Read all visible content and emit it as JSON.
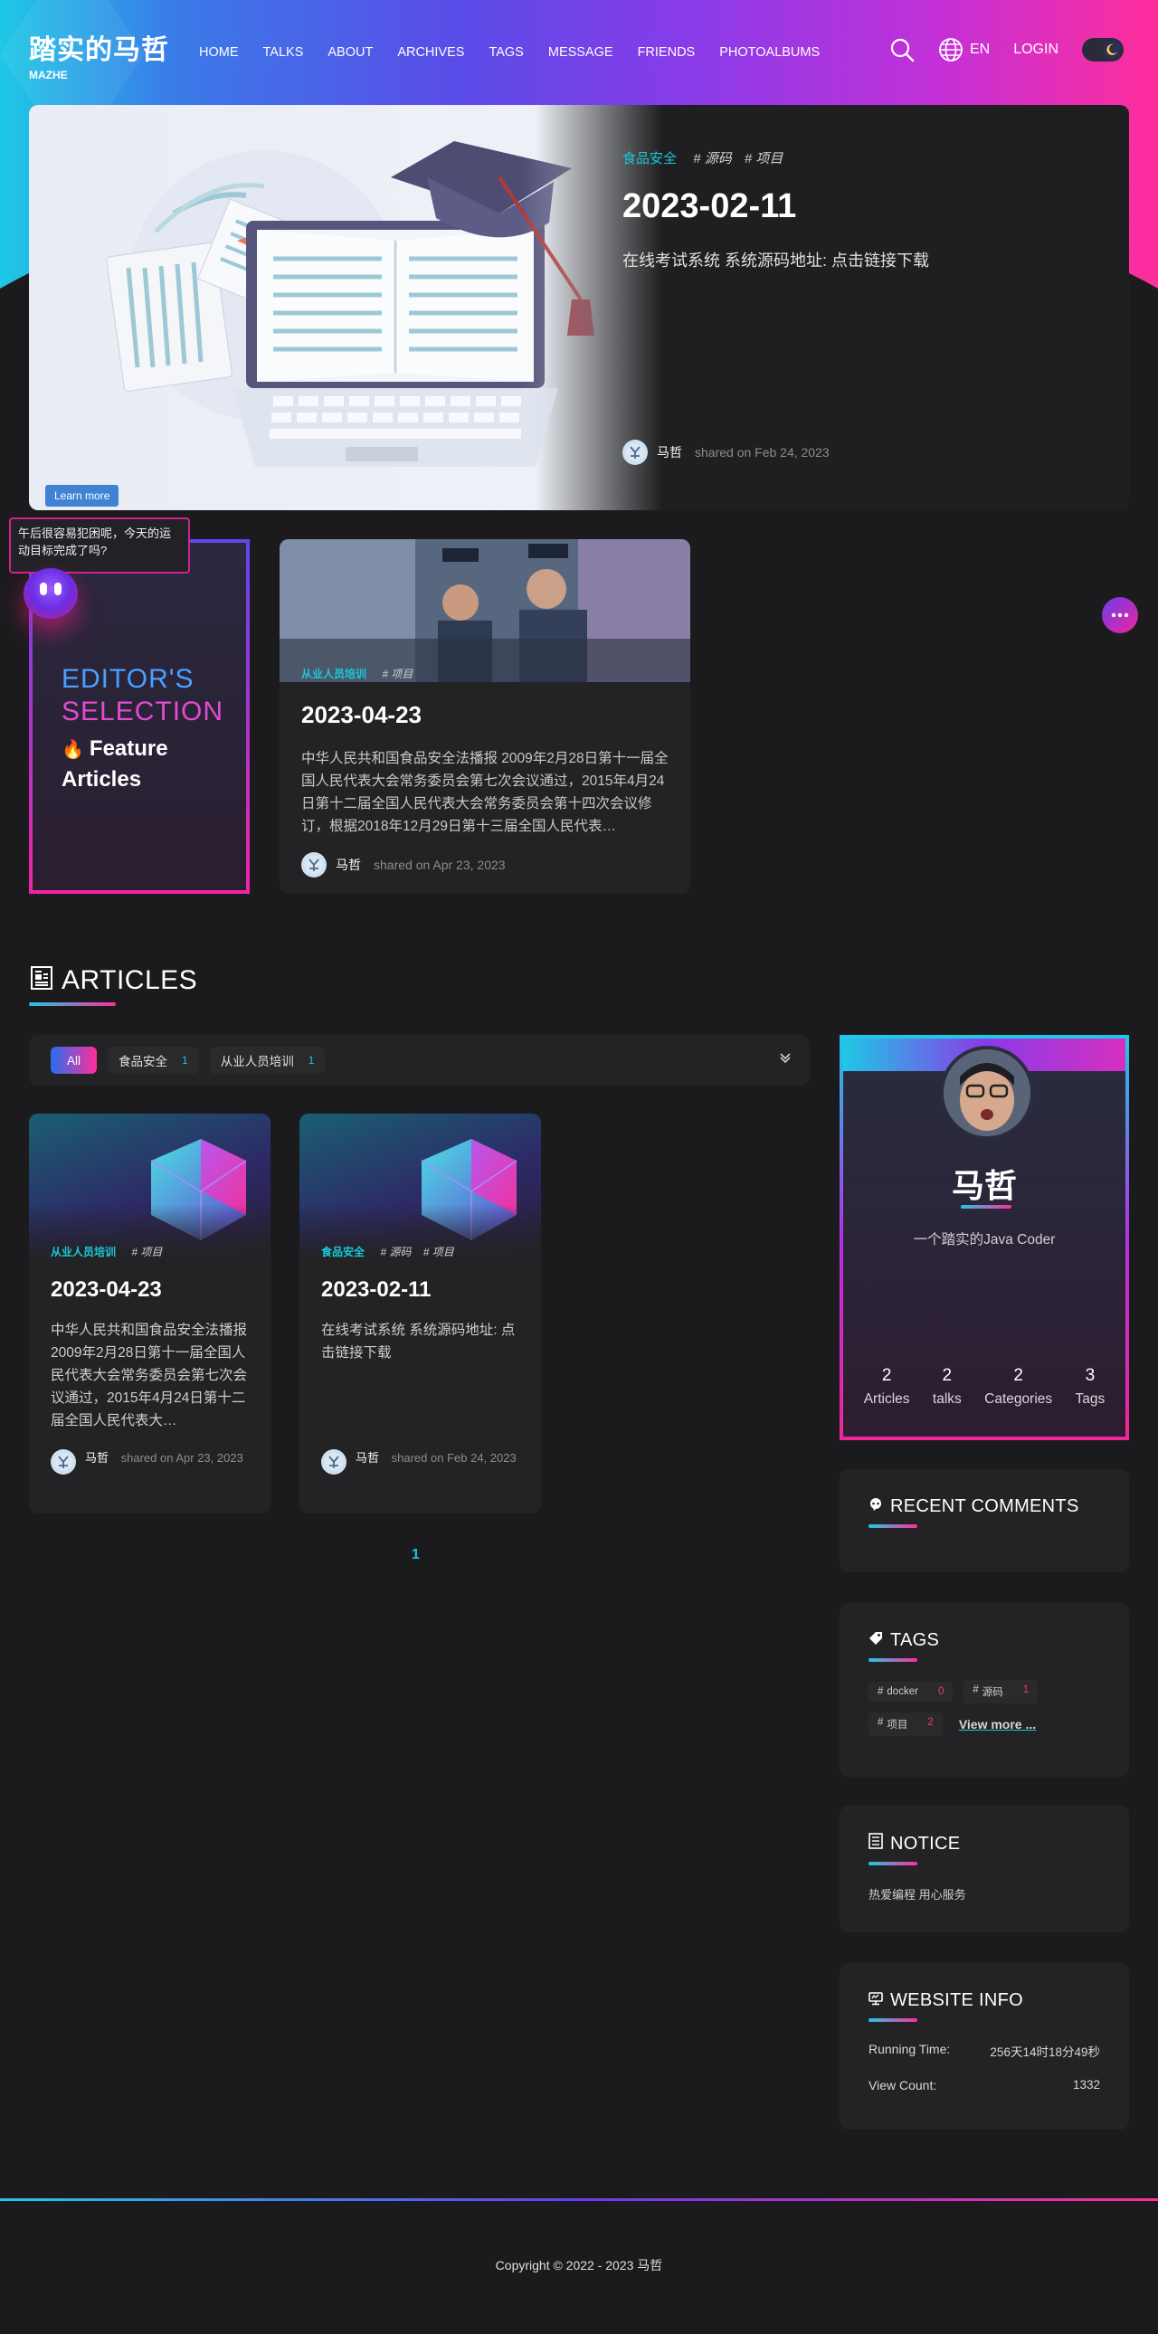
{
  "nav": {
    "brand_title": "踏实的马哲",
    "brand_sub": "MAZHE",
    "menu": [
      "HOME",
      "TALKS",
      "ABOUT",
      "ARCHIVES",
      "TAGS",
      "MESSAGE",
      "FRIENDS",
      "PHOTOALBUMS"
    ],
    "lang": "EN",
    "login": "LOGIN",
    "icons": {
      "search": "search-icon",
      "globe": "globe-icon",
      "theme": "moon-icon"
    }
  },
  "hero": {
    "category": "食品安全",
    "tags": [
      "# 源码",
      "# 项目"
    ],
    "date": "2023-02-11",
    "desc": "在线考试系统 系统源码地址: 点击链接下载",
    "author": "马哲",
    "shared": "shared on Feb 24, 2023",
    "learn_more": "Learn more"
  },
  "bubble": {
    "text": "午后很容易犯困呢，今天的运动目标完成了吗?"
  },
  "editor": {
    "line1": "EDITOR'S",
    "line2": "SELECTION",
    "line3": "Feature",
    "line4": "Articles"
  },
  "feature": {
    "category": "从业人员培训",
    "tags": [
      "# 项目"
    ],
    "date": "2023-04-23",
    "desc": "中华人民共和国食品安全法播报 2009年2月28日第十一届全国人民代表大会常务委员会第七次会议通过，2015年4月24日第十二届全国人民代表大会常务委员会第十四次会议修订，根据2018年12月29日第十三届全国人民代表…",
    "author": "马哲",
    "shared": "shared on Apr 23, 2023"
  },
  "articles_section": {
    "title": "ARTICLES",
    "filters": [
      {
        "label": "All",
        "count": ""
      },
      {
        "label": "食品安全",
        "count": "1"
      },
      {
        "label": "从业人员培训",
        "count": "1"
      }
    ],
    "cards": [
      {
        "category": "从业人员培训",
        "tags": [
          "# 项目"
        ],
        "date": "2023-04-23",
        "desc": "中华人民共和国食品安全法播报 2009年2月28日第十一届全国人民代表大会常务委员会第七次会议通过，2015年4月24日第十二届全国人民代表大…",
        "author": "马哲",
        "shared": "shared on Apr 23, 2023"
      },
      {
        "category": "食品安全",
        "tags": [
          "# 源码",
          "# 项目"
        ],
        "date": "2023-02-11",
        "desc": "在线考试系统 系统源码地址: 点击链接下载",
        "author": "马哲",
        "shared": "shared on Feb 24, 2023"
      }
    ],
    "page": "1"
  },
  "profile": {
    "name": "马哲",
    "bio": "一个踏实的Java Coder",
    "stats": [
      {
        "num": "2",
        "label": "Articles"
      },
      {
        "num": "2",
        "label": "talks"
      },
      {
        "num": "2",
        "label": "Categories"
      },
      {
        "num": "3",
        "label": "Tags"
      }
    ]
  },
  "recent_comments": {
    "title": "RECENT COMMENTS"
  },
  "tags_card": {
    "title": "TAGS",
    "items": [
      {
        "name": "docker",
        "count": "0"
      },
      {
        "name": "源码",
        "count": "1"
      },
      {
        "name": "项目",
        "count": "2"
      }
    ],
    "view_more": "View more ..."
  },
  "notice": {
    "title": "NOTICE",
    "text": "热爱编程 用心服务"
  },
  "website_info": {
    "title": "WEBSITE INFO",
    "running_label": "Running Time:",
    "running_value": "256天14时18分49秒",
    "view_label": "View Count:",
    "view_value": "1332"
  },
  "footer": {
    "copyright": "Copyright © 2022 - 2023 马哲"
  },
  "colors": {
    "accent_cyan": "#18c9d8",
    "accent_pink": "#ff2e9a",
    "accent_purple": "#6a3cf0",
    "bg": "#1b1b1d",
    "card": "#232325"
  }
}
